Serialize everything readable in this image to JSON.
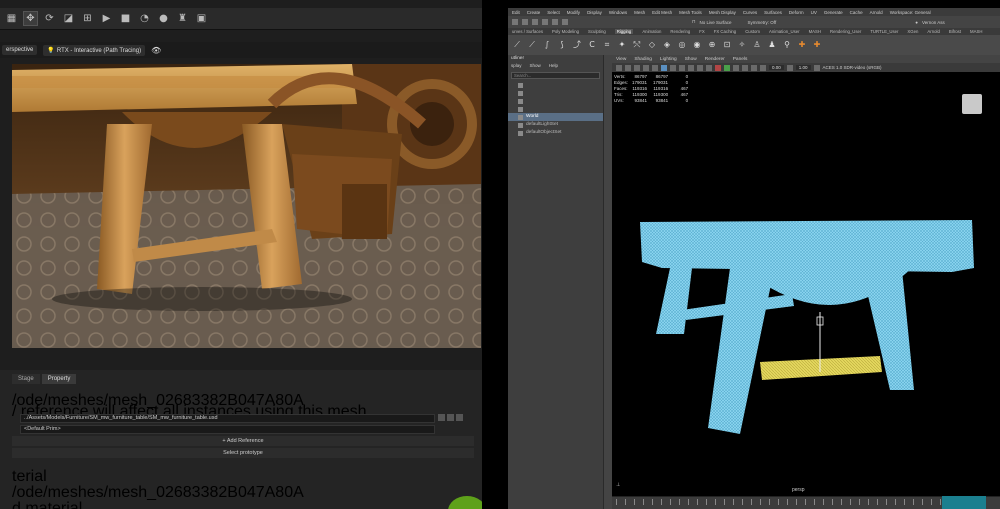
{
  "left_app": {
    "viewbar": {
      "camera_label": "erspective",
      "render_mode_label": "RTX - Interactive (Path Tracing)"
    },
    "panel": {
      "tabs": [
        "Stage",
        "Property"
      ],
      "active_tab": "Property",
      "prim_path": "/ode/meshes/mesh_02683382B047A80A",
      "ref_warning": "/ reference will affect all instances using this mesh.",
      "reference_path": "../Assets/Models/Furniture/SM_mw_furniture_table/SM_mw_furniture_table.usd",
      "default_prim": "<Default Prim>",
      "add_reference_label": "Add Reference",
      "select_prototype_label": "Select prototype",
      "section_material": "terial",
      "material_path": "/ode/meshes/mesh_02683382B047A80A",
      "bottom_label": "d material"
    }
  },
  "maya": {
    "menubar": [
      "Edit",
      "Create",
      "Select",
      "Modify",
      "Display",
      "Windows",
      "Mesh",
      "Edit Mesh",
      "Mesh Tools",
      "Mesh Display",
      "Curves",
      "Surfaces",
      "Deform",
      "UV",
      "Generate",
      "Cache",
      "Arnold",
      "Workspace: General"
    ],
    "statusline": {
      "live_surface": "No Live Surface",
      "symmetry": "Symmetry: Off",
      "user": "Vernon Ass"
    },
    "shelf_tabs": [
      "urves / Surfaces",
      "Poly Modeling",
      "Sculpting",
      "Rigging",
      "Animation",
      "Rendering",
      "FX",
      "FX Caching",
      "Custom",
      "Animation_User",
      "MASH",
      "Rendering_User",
      "TURTLE_User",
      "XGen",
      "Arnold",
      "Bifrost",
      "MASH"
    ],
    "active_shelf_tab": "Rigging",
    "outliner": {
      "title": "utliner",
      "menu": [
        "splay",
        "Show",
        "Help"
      ],
      "search_placeholder": "Search...",
      "items": [
        {
          "label": "",
          "style": "dim"
        },
        {
          "label": "",
          "style": "dim"
        },
        {
          "label": "",
          "style": "dim"
        },
        {
          "label": "",
          "style": "dim"
        },
        {
          "label": "World",
          "style": "selected"
        },
        {
          "label": "defaultLightSet",
          "style": "normal"
        },
        {
          "label": "defaultObjectSet",
          "style": "normal"
        }
      ]
    },
    "panel_menu": [
      "View",
      "Shading",
      "Lighting",
      "Show",
      "Renderer",
      "Panels"
    ],
    "panel_toolbar": {
      "near_value": "0.00",
      "far_value": "1.00",
      "color_space": "ACES 1.0 SDR-video (sRGB)"
    },
    "hud": {
      "rows": [
        {
          "label": "Verts:",
          "a": "86797",
          "b": "86797",
          "c": "0"
        },
        {
          "label": "Edges:",
          "a": "179031",
          "b": "179031",
          "c": "0"
        },
        {
          "label": "Faces:",
          "a": "119316",
          "b": "119316",
          "c": "467"
        },
        {
          "label": "Tris:",
          "a": "119300",
          "b": "119300",
          "c": "467"
        },
        {
          "label": "UVs:",
          "a": "93841",
          "b": "93841",
          "c": "0"
        }
      ]
    },
    "camera_label": "persp"
  },
  "colors": {
    "wireframe_blue": "#7fd3f0",
    "wireframe_yellow": "#e0d35a",
    "viewport_bg": "#000000",
    "selected_row": "#5a6f86"
  }
}
